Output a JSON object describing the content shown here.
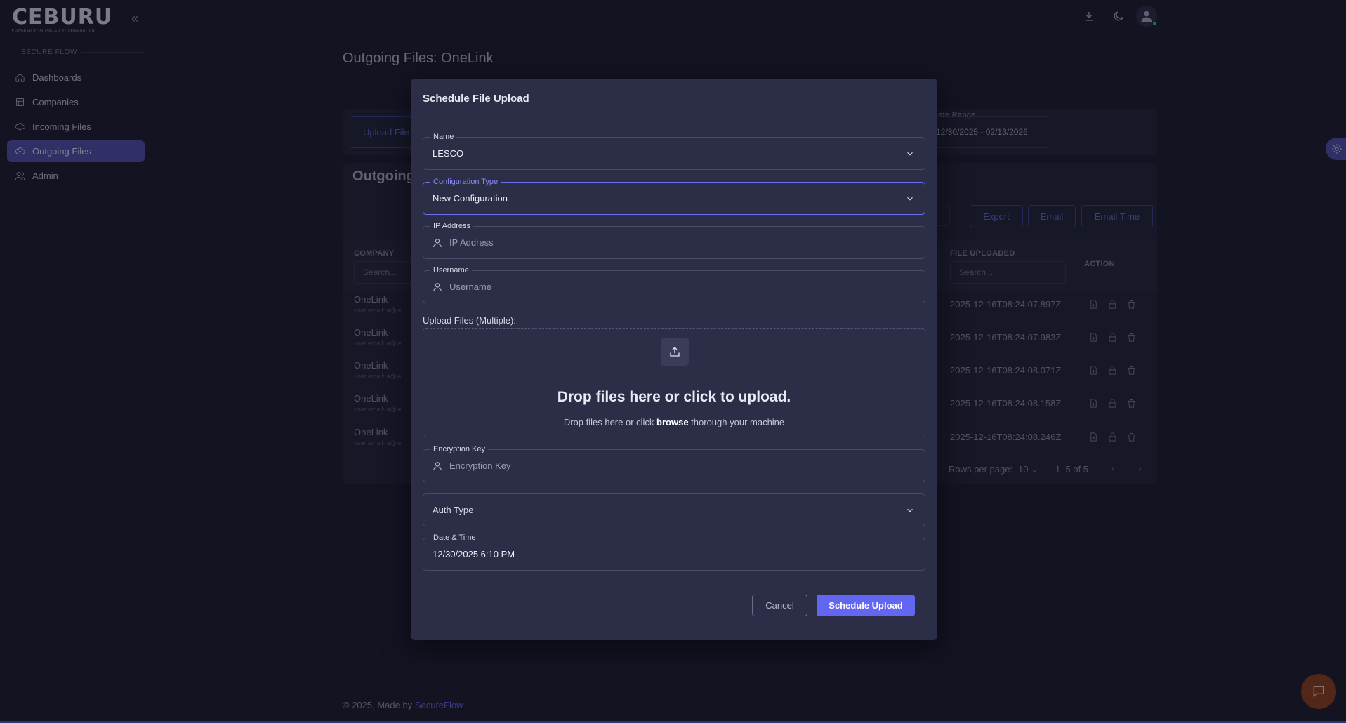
{
  "app": {
    "logo_text": "CEBURU",
    "logo_tagline": "POWERED BY AI FUELED BY INTEGRATION",
    "collapse_icon": "chevrons-left-icon"
  },
  "sidebar": {
    "section_label": "SECURE FLOW",
    "items": [
      {
        "label": "Dashboards",
        "icon": "home-icon",
        "active": false
      },
      {
        "label": "Companies",
        "icon": "building-icon",
        "active": false
      },
      {
        "label": "Incoming Files",
        "icon": "cloud-download-icon",
        "active": false
      },
      {
        "label": "Outgoing Files",
        "icon": "cloud-upload-icon",
        "active": true
      },
      {
        "label": "Admin",
        "icon": "users-icon",
        "active": false
      }
    ]
  },
  "header": {
    "icons": [
      "download-icon",
      "moon-icon",
      "user-avatar-icon"
    ]
  },
  "background_page": {
    "title": "Outgoing Files: OneLink",
    "upload_button": "Upload File",
    "date_range_label": "Date Range",
    "date_range_value": "12/30/2025 - 02/13/2026",
    "card_title": "Outgoing",
    "buttons": [
      "Export",
      "Email",
      "Email Time"
    ],
    "columns": {
      "company": "COMPANY",
      "file_uploaded": "FILE UPLOADED",
      "action": "ACTION"
    },
    "search_placeholder": "Search...",
    "rows": [
      {
        "company": "OneLink",
        "sub": "user email: a@ie",
        "uploaded": "2025-12-16T08:24:07.897Z"
      },
      {
        "company": "OneLink",
        "sub": "user email: a@ie",
        "uploaded": "2025-12-16T08:24:07.983Z"
      },
      {
        "company": "OneLink",
        "sub": "user email: a@ie",
        "uploaded": "2025-12-16T08:24:08.071Z"
      },
      {
        "company": "OneLink",
        "sub": "user email: a@ie",
        "uploaded": "2025-12-16T08:24:08.158Z"
      },
      {
        "company": "OneLink",
        "sub": "user email: a@ie",
        "uploaded": "2025-12-16T08:24:08.246Z"
      }
    ],
    "rows_per_page_label": "Rows per page:",
    "rows_per_page_value": "10",
    "pagination_text": "1–5 of 5"
  },
  "footer": {
    "text": "© 2025, Made by ",
    "link": "SecureFlow"
  },
  "modal": {
    "title": "Schedule File Upload",
    "name_field": {
      "label": "Name",
      "value": "LESCO"
    },
    "config_field": {
      "label": "Configuration Type",
      "value": "New Configuration"
    },
    "ip_field": {
      "label": "IP Address",
      "placeholder": "IP Address"
    },
    "username_field": {
      "label": "Username",
      "placeholder": "Username"
    },
    "upload_label": "Upload Files (Multiple):",
    "dropzone_title": "Drop files here or click to upload.",
    "dropzone_sub_before": "Drop files here or click ",
    "dropzone_sub_link": "browse",
    "dropzone_sub_after": " thorough your machine",
    "encryption_field": {
      "label": "Encryption Key",
      "placeholder": "Encryption Key"
    },
    "auth_field": {
      "placeholder": "Auth Type"
    },
    "datetime_field": {
      "label": "Date & Time",
      "value": "12/30/2025 6:10 PM"
    },
    "cancel_label": "Cancel",
    "submit_label": "Schedule Upload"
  },
  "colors": {
    "background": "#1a1b2c",
    "modal": "#2c2e48",
    "accent": "#6366f1",
    "nav_active": "#4f4fa8",
    "chat_fab": "#8b3f1c"
  }
}
